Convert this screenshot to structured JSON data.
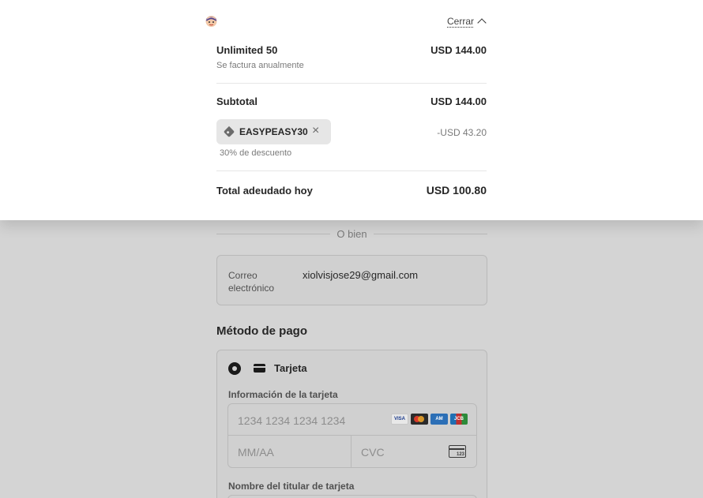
{
  "summary": {
    "close_label": "Cerrar",
    "item": {
      "name": "Unlimited 50",
      "billing": "Se factura anualmente",
      "price": "USD 144.00"
    },
    "subtotal": {
      "label": "Subtotal",
      "value": "USD 144.00"
    },
    "coupon": {
      "code": "EASYPEASY30",
      "discount_value": "-USD 43.20",
      "note": "30% de descuento"
    },
    "total": {
      "label": "Total adeudado hoy",
      "value": "USD 100.80"
    }
  },
  "divider_text": "O bien",
  "contact": {
    "email_label": "Correo electrónico",
    "email_value": "xiolvisjose29@gmail.com"
  },
  "payment": {
    "title": "Método de pago",
    "option_label": "Tarjeta",
    "card_info_label": "Información de la tarjeta",
    "card_number_placeholder": "1234 1234 1234 1234",
    "expiry_placeholder": "MM/AA",
    "cvc_placeholder": "CVC",
    "brand_icons": [
      "visa-icon",
      "mastercard-icon",
      "amex-icon",
      "jcb-icon"
    ],
    "holder_label": "Nombre del titular de tarjeta"
  }
}
